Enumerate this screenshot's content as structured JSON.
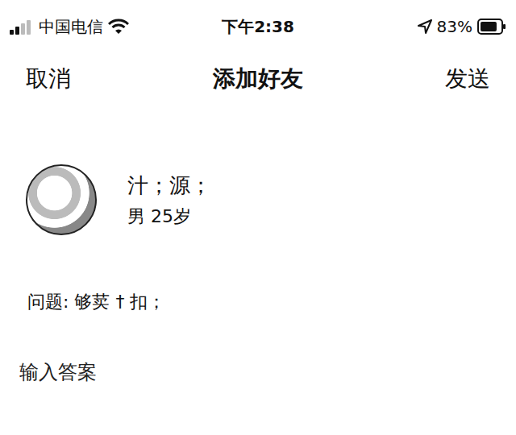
{
  "status_bar": {
    "carrier": "中国电信",
    "time": "下午2:38",
    "battery": "83%",
    "battery_level": 0.83,
    "signal_level": 0.5
  },
  "nav": {
    "cancel": "取消",
    "title": "添加好友",
    "send": "发送"
  },
  "profile": {
    "name": "汁；源；",
    "info": "男 25岁"
  },
  "question": {
    "text": "问题: 够荬 † 扣；"
  },
  "answer": {
    "placeholder": "输入答案"
  }
}
